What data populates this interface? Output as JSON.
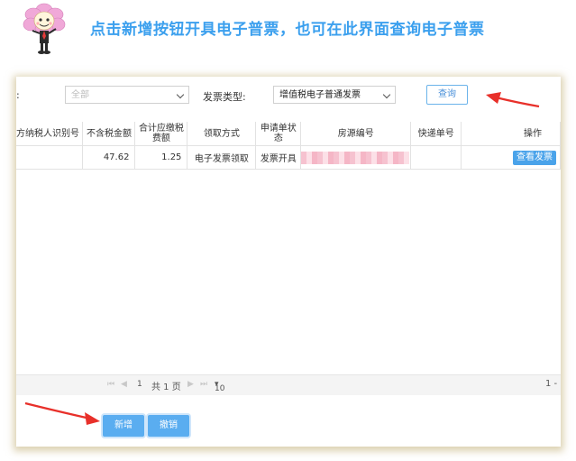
{
  "headline": "点击新增按钮开具电子普票，也可在此界面查询电子普票",
  "filters": {
    "left_label_fragment": ":",
    "status_value": "全部",
    "invoice_type_label": "发票类型:",
    "invoice_type_value": "增值税电子普通发票",
    "query_label": "查询"
  },
  "table": {
    "headers": [
      "方纳税人识别号",
      "不含税金额",
      "合计应缴税费额",
      "领取方式",
      "申请单状态",
      "房源编号",
      "快递单号",
      "操作"
    ],
    "header_lines": {
      "tax_total": [
        "合计应缴税",
        "费额"
      ],
      "app_status": [
        "申请单状",
        "态"
      ]
    },
    "rows": [
      {
        "taxpayer_id": "",
        "amount_ex_tax": "47.62",
        "tax_total": "1.25",
        "pickup_method": "电子发票领取",
        "status": "发票开具",
        "property_no": "",
        "express_no": "",
        "action": "查看发票"
      }
    ]
  },
  "pager": {
    "first": "⏮",
    "prev": "◀",
    "page": "1",
    "total": "共 1 页",
    "next": "▶",
    "last": "⏭",
    "page_size": "10",
    "range_fragment": "1 -"
  },
  "buttons": {
    "add": "新增",
    "revoke": "撤销"
  },
  "colors": {
    "headline": "#3ca0ee",
    "button": "#5aadf0",
    "arrow": "#e8302a",
    "panel_shadow": "#bea86e"
  }
}
